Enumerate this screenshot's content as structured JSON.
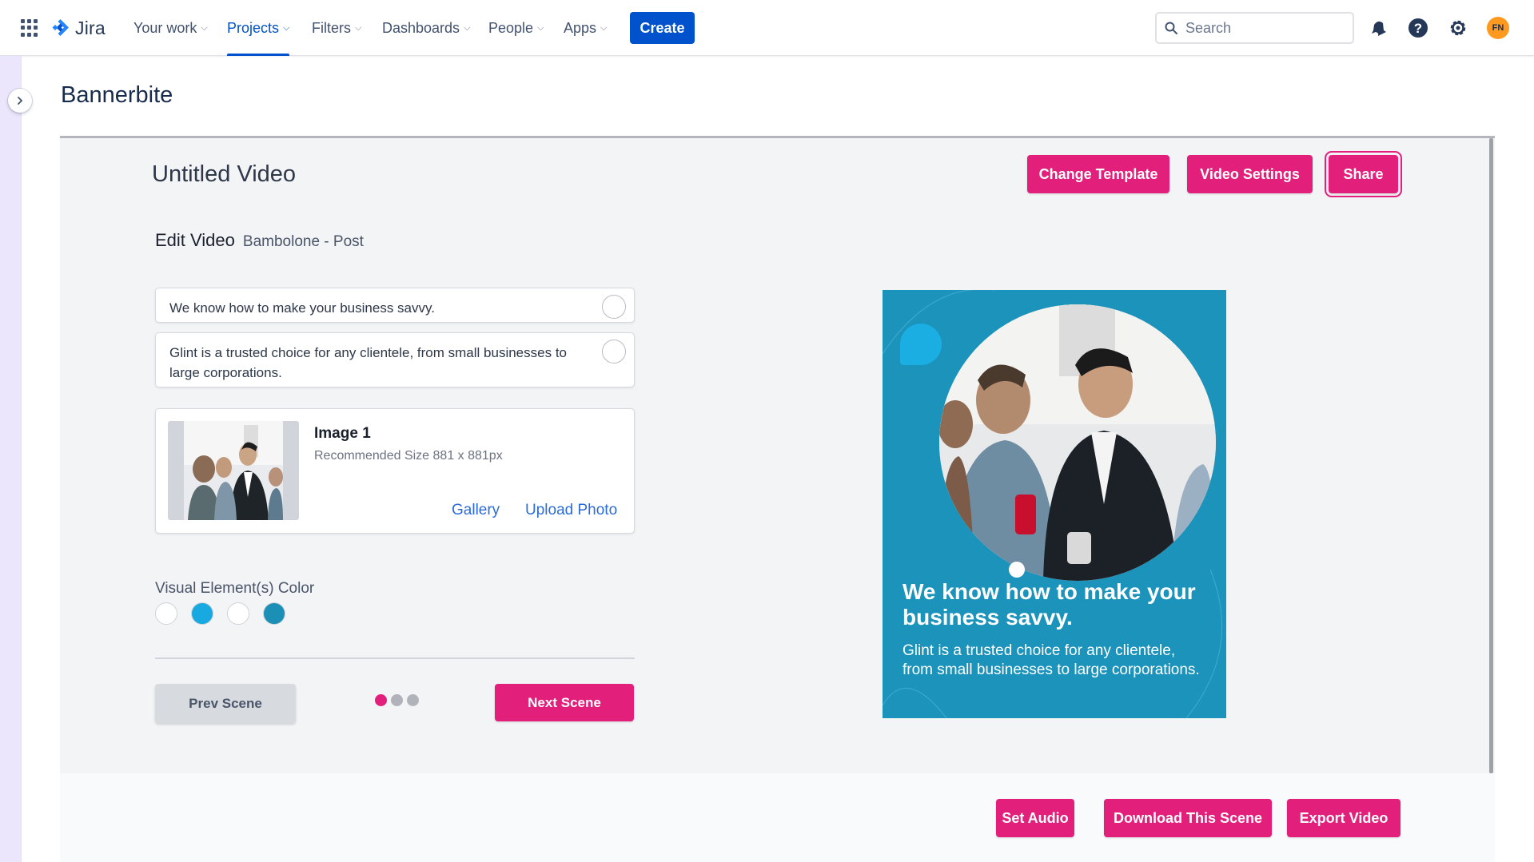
{
  "nav": {
    "logo": "Jira",
    "items": [
      "Your work",
      "Projects",
      "Filters",
      "Dashboards",
      "People",
      "Apps"
    ],
    "active_item": "Projects",
    "create_label": "Create",
    "search_placeholder": "Search",
    "avatar_initials": "FN",
    "brand_color": "#0052cc"
  },
  "page": {
    "title": "Bannerbite"
  },
  "editor": {
    "video_title": "Untitled Video",
    "buttons": {
      "change_template": "Change Template",
      "video_settings": "Video Settings",
      "share": "Share"
    },
    "edit_heading": "Edit Video",
    "template_name": "Bambolone - Post",
    "text_fields": [
      "We know how to make your business savvy.",
      "Glint is a trusted choice for any clientele, from small businesses to large corporations."
    ],
    "image": {
      "title": "Image 1",
      "recommended": "Recommended Size 881 x 881px",
      "gallery_label": "Gallery",
      "upload_label": "Upload Photo"
    },
    "visual_color_label": "Visual Element(s) Color",
    "colors": [
      "#ffffff",
      "#17a9df",
      "#ffffff",
      "#1b8fb5"
    ],
    "prev_label": "Prev Scene",
    "next_label": "Next Scene",
    "scene_count": 3,
    "current_scene": 1,
    "accent_color": "#e21f7b"
  },
  "preview": {
    "headline": "We know how to make your business savvy.",
    "body": "Glint is a trusted choice for any clientele, from small businesses to large corporations.",
    "background": "#1b93bb"
  },
  "footer": {
    "set_audio": "Set Audio",
    "download_scene": "Download This Scene",
    "export_video": "Export Video"
  }
}
